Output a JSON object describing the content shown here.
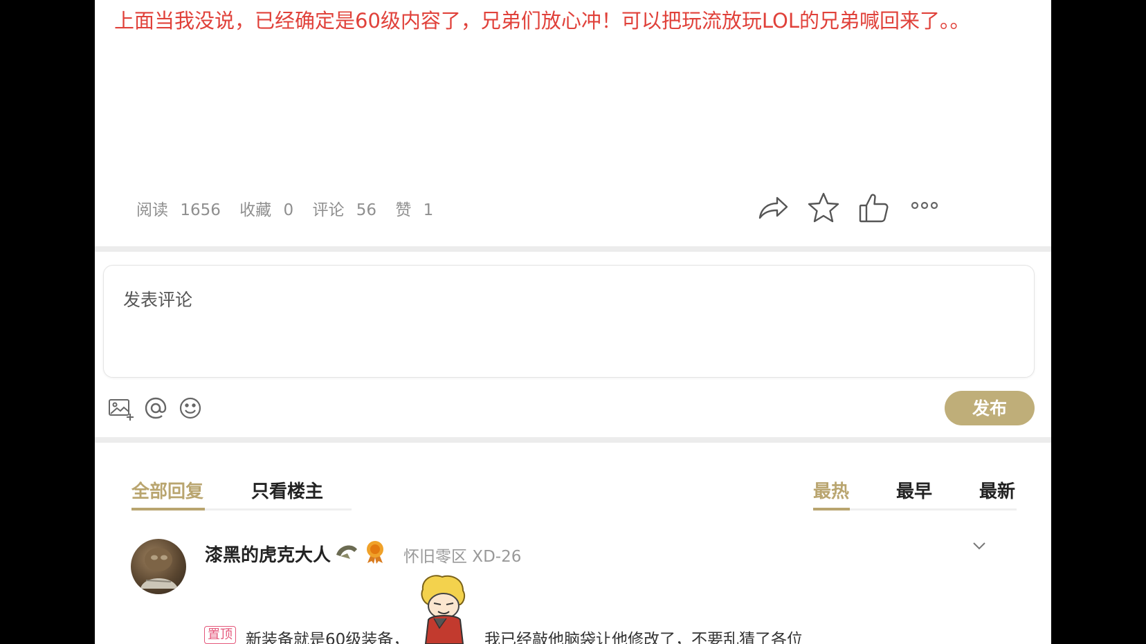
{
  "post": {
    "text": "上面当我没说，已经确定是60级内容了，兄弟们放心冲！可以把玩流放玩LOL的兄弟喊回来了。。"
  },
  "stats": {
    "read_label": "阅读",
    "read": "1656",
    "fav_label": "收藏",
    "fav": "0",
    "comment_label": "评论",
    "comment": "56",
    "like_label": "赞",
    "like": "1"
  },
  "actions": {
    "share_icon": "share-icon",
    "star_icon": "star-icon",
    "thumb_icon": "thumbs-up-icon",
    "more_icon": "more-icon"
  },
  "comment_box": {
    "placeholder": "发表评论",
    "publish_label": "发布",
    "tools": [
      "image-icon",
      "at-icon",
      "emoji-icon"
    ]
  },
  "tabs": {
    "left": [
      "全部回复",
      "只看楼主"
    ],
    "right": [
      "最热",
      "最早",
      "最新"
    ],
    "active_left": "全部回复",
    "active_right": "最热"
  },
  "reply": {
    "username": "漆黑的虎克大人",
    "server": "怀旧零区 XD-26",
    "pinned_label": "置顶",
    "text_part1": "新装备就是60级装备，",
    "text_part2": "我已经敲他脑袋让他修改了，不要乱猜了各位"
  },
  "colors": {
    "accent": "#b9a56f",
    "post_text": "#e0413a",
    "pinned": "#e4567a"
  }
}
